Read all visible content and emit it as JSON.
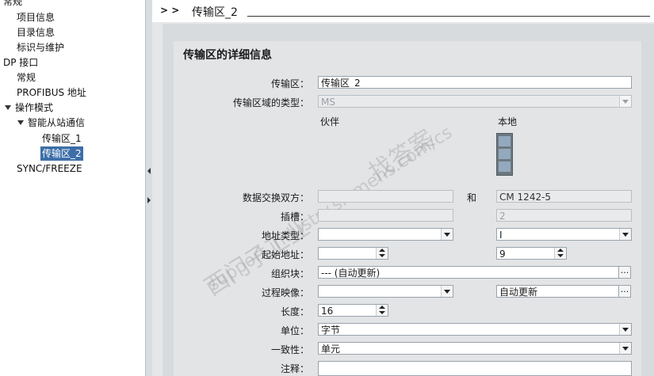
{
  "tree": {
    "items": [
      {
        "label": "常规"
      },
      {
        "label": "项目信息"
      },
      {
        "label": "目录信息"
      },
      {
        "label": "标识与维护"
      },
      {
        "label": "DP 接口"
      },
      {
        "label": "常规"
      },
      {
        "label": "PROFIBUS 地址"
      },
      {
        "label": "操作模式"
      },
      {
        "label": "智能从站通信"
      },
      {
        "label": "传输区_1"
      },
      {
        "label": "传输区_2"
      },
      {
        "label": "SYNC/FREEZE"
      }
    ]
  },
  "breadcrumb": {
    "arrows": "> >",
    "title": "传输区_2"
  },
  "section": {
    "title": "传输区的详细信息"
  },
  "columns": {
    "partner": "伙伴",
    "local": "本地",
    "and": "和"
  },
  "form": {
    "transfer_area": {
      "label": "传输区",
      "value": "传输区_2"
    },
    "area_type": {
      "label": "传输区域的类型",
      "value": "MS"
    },
    "exchange_partners": {
      "label": "数据交换双方",
      "partner_value": "",
      "local_value": "CM 1242-5"
    },
    "slot": {
      "label": "插槽",
      "partner_value": "",
      "local_value": "2"
    },
    "address_type": {
      "label": "地址类型",
      "partner_value": "",
      "local_value": "I"
    },
    "start_address": {
      "label": "起始地址",
      "partner_value": "",
      "local_value": "9"
    },
    "org_block": {
      "label": "组织块",
      "value": "--- (自动更新)"
    },
    "process_image": {
      "label": "过程映像",
      "partner_value": "",
      "local_value": "自动更新"
    },
    "length": {
      "label": "长度",
      "value": "16"
    },
    "unit": {
      "label": "单位",
      "value": "字节"
    },
    "consistency": {
      "label": "一致性",
      "value": "单元"
    },
    "comment": {
      "label": "注释",
      "value": ""
    }
  },
  "browse_label": "...",
  "watermark": {
    "line1": "西门子工业",
    "line2": "找答案",
    "line3": "support.industry.siemens.com/cs"
  }
}
